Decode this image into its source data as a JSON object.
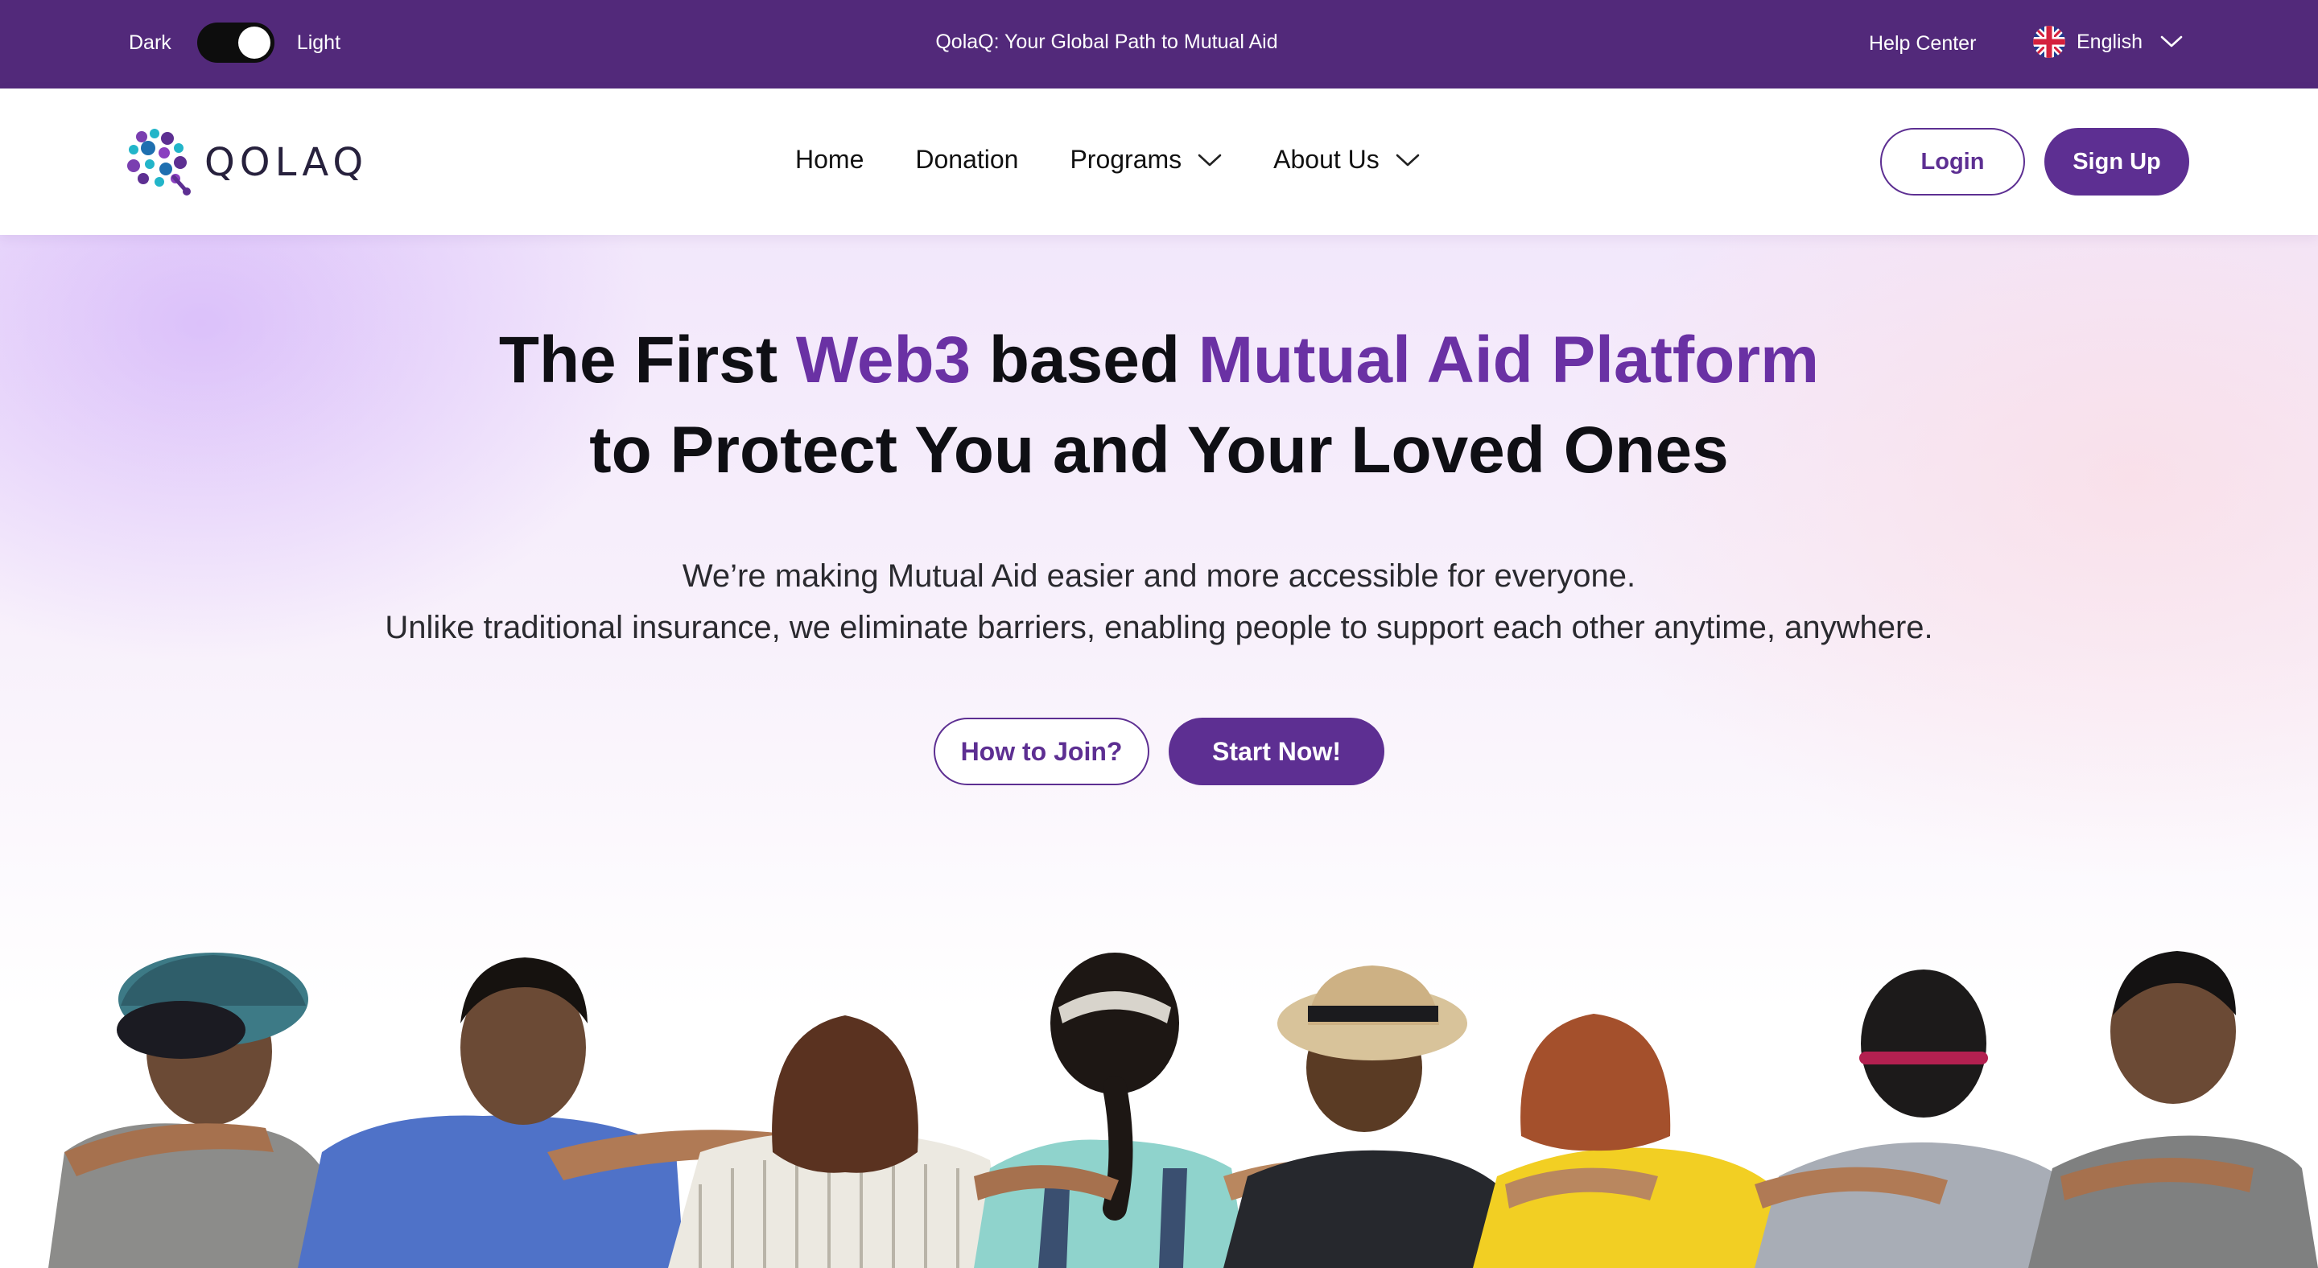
{
  "topbar": {
    "theme_dark_label": "Dark",
    "theme_light_label": "Light",
    "theme_state": "light",
    "tagline": "QolaQ: Your Global Path to Mutual Aid",
    "help_label": "Help Center",
    "language_label": "English",
    "language_icon": "uk-flag-icon"
  },
  "navbar": {
    "logo_text": "QOLAQ",
    "links": [
      {
        "label": "Home"
      },
      {
        "label": "Donation"
      },
      {
        "label": "Programs",
        "has_dropdown": true
      },
      {
        "label": "About Us",
        "has_dropdown": true
      }
    ],
    "login_label": "Login",
    "signup_label": "Sign Up"
  },
  "hero": {
    "headline_part1": "The First ",
    "headline_hl1": "Web3",
    "headline_part2": " based ",
    "headline_hl2": "Mutual Aid Platform",
    "headline_line2": "to Protect You and Your Loved Ones",
    "sub_line1": "We’re making Mutual Aid easier and more accessible for everyone.",
    "sub_line2": "Unlike traditional insurance, we eliminate barriers, enabling people to support each other anytime, anywhere.",
    "join_label": "How to Join?",
    "start_label": "Start Now!",
    "image_desc": "Group of friends seen from behind with arms around each other"
  },
  "colors": {
    "topbar_bg": "#52297a",
    "brand_purple": "#5d2f92",
    "headline_highlight": "#6a31a4"
  }
}
